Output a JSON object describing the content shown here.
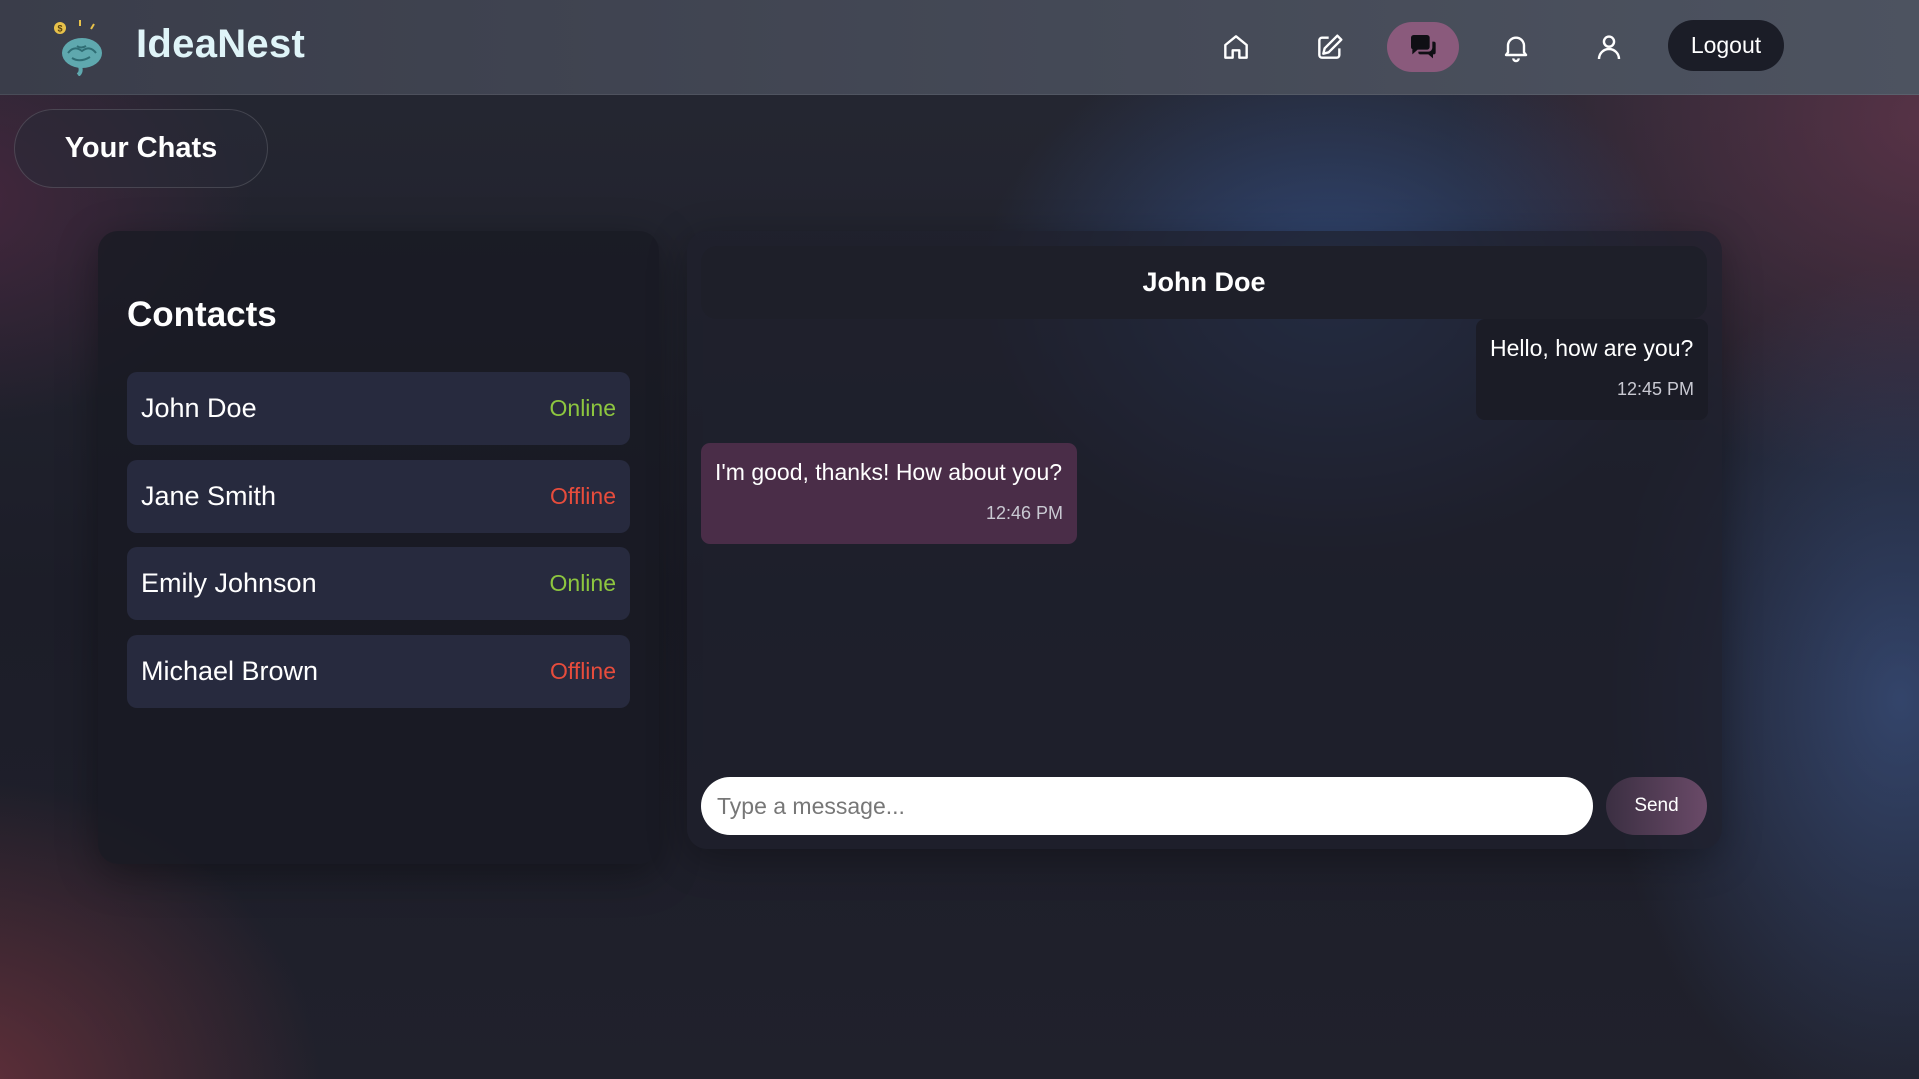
{
  "header": {
    "app_name": "IdeaNest",
    "nav": [
      {
        "name": "home-icon",
        "active": false
      },
      {
        "name": "edit-icon",
        "active": false
      },
      {
        "name": "chat-icon",
        "active": true
      },
      {
        "name": "bell-icon",
        "active": false
      },
      {
        "name": "user-icon",
        "active": false
      }
    ],
    "logout_label": "Logout"
  },
  "section_tab": "Your Chats",
  "contacts": {
    "title": "Contacts",
    "items": [
      {
        "name": "John Doe",
        "status": "Online"
      },
      {
        "name": "Jane Smith",
        "status": "Offline"
      },
      {
        "name": "Emily Johnson",
        "status": "Online"
      },
      {
        "name": "Michael Brown",
        "status": "Offline"
      }
    ]
  },
  "chat": {
    "title": "John Doe",
    "messages": [
      {
        "direction": "sent",
        "text": "Hello, how are you?",
        "time": "12:45 PM"
      },
      {
        "direction": "received",
        "text": "I'm good, thanks! How about you?",
        "time": "12:46 PM"
      }
    ],
    "input_placeholder": "Type a message...",
    "input_value": "",
    "send_label": "Send"
  },
  "colors": {
    "online": "#8dc63f",
    "offline": "#e74c3c",
    "active_nav": "#8a5a7c",
    "received_bubble": "#4a2d48"
  }
}
